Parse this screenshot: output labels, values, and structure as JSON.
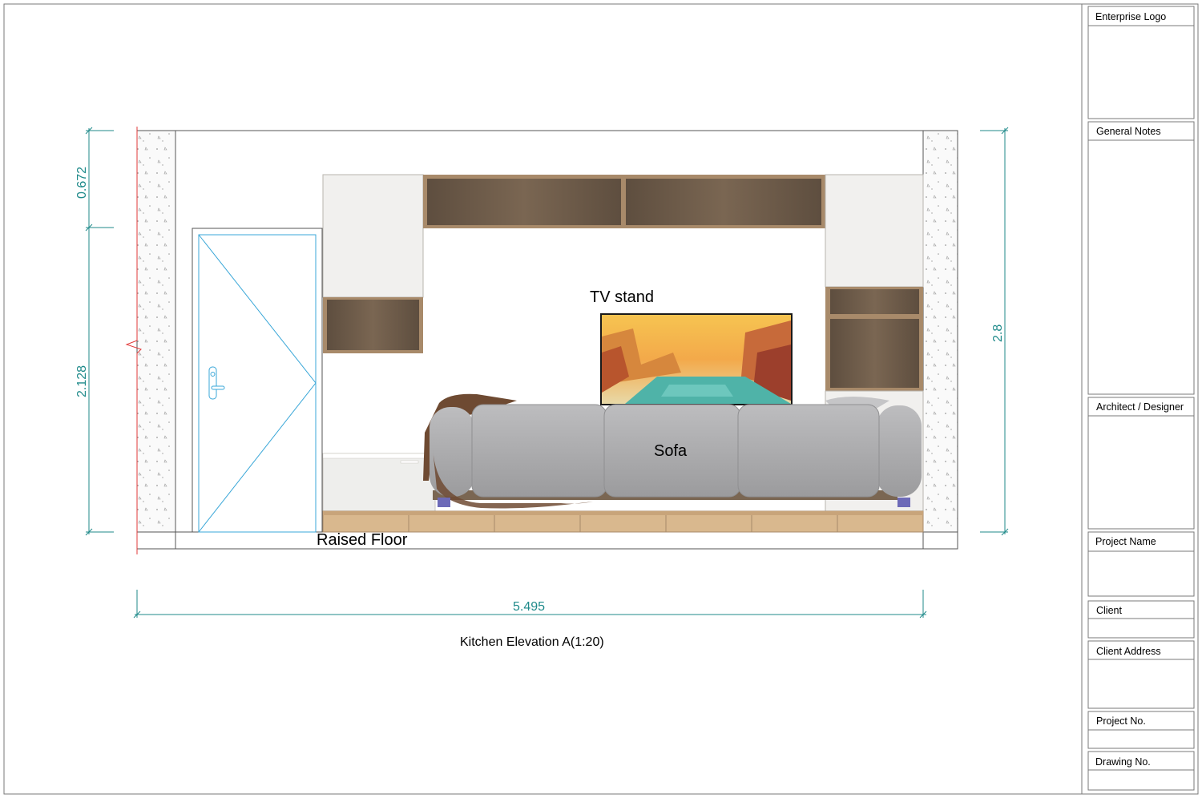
{
  "drawing": {
    "title": "Kitchen Elevation A(1:20)",
    "labels": {
      "tv_stand": "TV stand",
      "sofa": "Sofa",
      "raised_floor": "Raised Floor"
    },
    "dimensions": {
      "top_height": "0.672",
      "door_height": "2.128",
      "total_height": "2.8",
      "total_width": "5.495"
    }
  },
  "title_block": {
    "enterprise_logo": "Enterprise Logo",
    "general_notes": "General Notes",
    "architect_designer": "Architect / Designer",
    "project_name": "Project Name",
    "client": "Client",
    "client_address": "Client Address",
    "project_no": "Project No.",
    "drawing_no": "Drawing No."
  },
  "colors": {
    "dimension": "#1f8a8a",
    "wood": "#6f5d4b",
    "wood_frame": "#a88a6a",
    "floor_wood": "#d9b88e",
    "sofa": "#a9a9ab",
    "door_lines": "#3aa7d8"
  }
}
